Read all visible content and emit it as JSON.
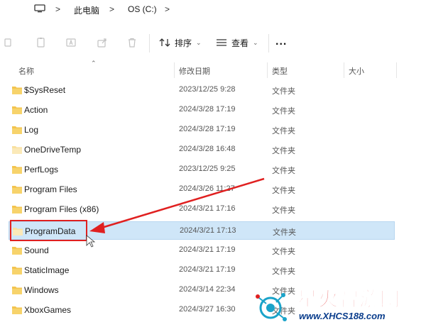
{
  "address": {
    "crumbs": [
      "此电脑",
      "OS (C:)"
    ],
    "separator": ">"
  },
  "toolbar": {
    "sort_label": "排序",
    "view_label": "查看",
    "more_label": "..."
  },
  "columns": {
    "name": "名称",
    "modified": "修改日期",
    "type": "类型",
    "size": "大小"
  },
  "rows": [
    {
      "name": "$SysReset",
      "date": "2023/12/25 9:28",
      "type": "文件夹"
    },
    {
      "name": "Action",
      "date": "2024/3/28 17:19",
      "type": "文件夹"
    },
    {
      "name": "Log",
      "date": "2024/3/28 17:19",
      "type": "文件夹"
    },
    {
      "name": "OneDriveTemp",
      "date": "2024/3/28 16:48",
      "type": "文件夹"
    },
    {
      "name": "PerfLogs",
      "date": "2023/12/25 9:25",
      "type": "文件夹"
    },
    {
      "name": "Program Files",
      "date": "2024/3/26 11:27",
      "type": "文件夹"
    },
    {
      "name": "Program Files (x86)",
      "date": "2024/3/21 17:16",
      "type": "文件夹"
    },
    {
      "name": "ProgramData",
      "date": "2024/3/21 17:13",
      "type": "文件夹"
    },
    {
      "name": "Sound",
      "date": "2024/3/21 17:19",
      "type": "文件夹"
    },
    {
      "name": "StaticImage",
      "date": "2024/3/21 17:19",
      "type": "文件夹"
    },
    {
      "name": "Windows",
      "date": "2024/3/14 22:34",
      "type": "文件夹"
    },
    {
      "name": "XboxGames",
      "date": "2024/3/27 16:30",
      "type": "文件夹"
    }
  ],
  "selected_row": 7,
  "watermark": {
    "brand": "星火智游网",
    "site": "www.XHCS188.com"
  },
  "colors": {
    "selection_bg": "#cfe6f8",
    "annotation_red": "#e02020",
    "folder_yellow": "#f3c44f"
  }
}
